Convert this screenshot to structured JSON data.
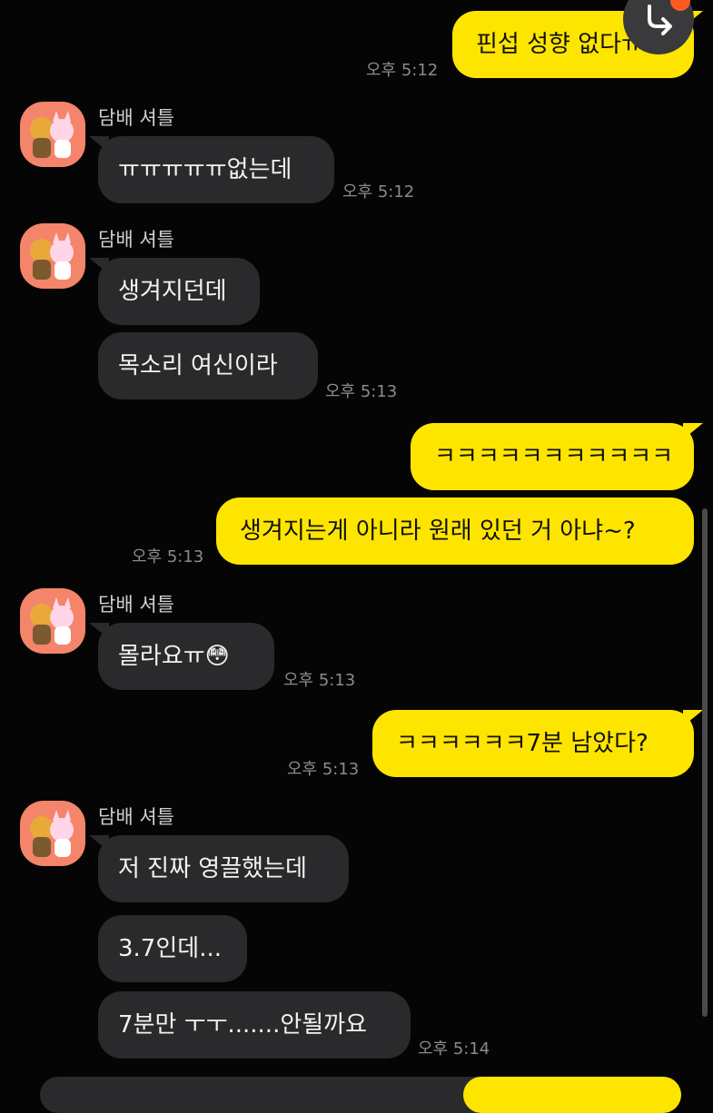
{
  "chat": {
    "sender_name": "담배 셔틀",
    "messages": [
      {
        "text": "핀섭 성향 없다ㅠ",
        "time": "오후 5:12"
      },
      {
        "text": "ㅠㅠㅠㅠㅠ없는데",
        "time": "오후 5:12"
      },
      {
        "text": "생겨지던데"
      },
      {
        "text": "목소리 여신이라",
        "time": "오후 5:13"
      },
      {
        "text": "ㅋㅋㅋㅋㅋㅋㅋㅋㅋㅋㅋ"
      },
      {
        "text": "생겨지는게 아니라 원래 있던 거 아냐~?",
        "time": "오후 5:13"
      },
      {
        "text": "몰라요ㅠ😳",
        "time": "오후 5:13"
      },
      {
        "text": "ㅋㅋㅋㅋㅋㅋ7분 남았다?",
        "time": "오후 5:13"
      },
      {
        "text": "저 진짜 영끌했는데"
      },
      {
        "text": "3.7인데..."
      },
      {
        "text": "7분만 ㅜㅜ.......안될까요",
        "time": "오후 5:14"
      }
    ]
  },
  "reply_button": {
    "icon": "reply-arrow-icon"
  },
  "colors": {
    "my_bubble": "#fee500",
    "their_bubble": "#2a2a2c",
    "background": "#050505"
  }
}
